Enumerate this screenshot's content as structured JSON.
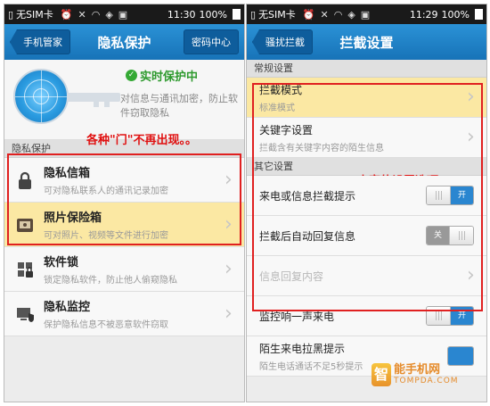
{
  "left_screen": {
    "status": {
      "sim": "无SIM卡",
      "time": "11:30",
      "battery": "100%"
    },
    "titlebar": {
      "back": "手机管家",
      "title": "隐私保护",
      "action": "密码中心"
    },
    "hero": {
      "status": "实时保护中",
      "desc": "对信息与通讯加密，防止软件窃取隐私"
    },
    "section": "隐私保护",
    "annotation": "各种\"门\"不再出现。。",
    "items": [
      {
        "title": "隐私信箱",
        "subtitle": "可对隐私联系人的通讯记录加密"
      },
      {
        "title": "照片保险箱",
        "subtitle": "可对照片、视频等文件进行加密"
      },
      {
        "title": "软件锁",
        "subtitle": "锁定隐私软件，防止他人偷窥隐私"
      },
      {
        "title": "隐私监控",
        "subtitle": "保护隐私信息不被恶意软件窃取"
      }
    ]
  },
  "right_screen": {
    "status": {
      "sim": "无SIM卡",
      "time": "11:29",
      "battery": "100%"
    },
    "titlebar": {
      "back": "骚扰拦截",
      "title": "拦截设置"
    },
    "section_general": "常规设置",
    "section_other": "其它设置",
    "annotation": "丰富的设置选项",
    "general": [
      {
        "title": "拦截模式",
        "subtitle": "标准模式"
      },
      {
        "title": "关键字设置",
        "subtitle": "拦截含有关键字内容的陌生信息"
      }
    ],
    "other": [
      {
        "title": "来电或信息拦截提示",
        "toggle": "开"
      },
      {
        "title": "拦截后自动回复信息",
        "toggle": "关"
      },
      {
        "title": "信息回复内容"
      },
      {
        "title": "监控响一声来电",
        "toggle": "开"
      },
      {
        "title": "陌生来电拉黑提示",
        "subtitle": "陌生电话通话不足5秒提示"
      }
    ],
    "watermark": {
      "name": "能手机网",
      "domain": "TOMPDA.COM",
      "logo": "智"
    }
  },
  "colors": {
    "accent": "#1e84cc",
    "highlight": "#fbe8a3",
    "annotation": "#e01010",
    "toggle_on": "#2a86d0"
  }
}
